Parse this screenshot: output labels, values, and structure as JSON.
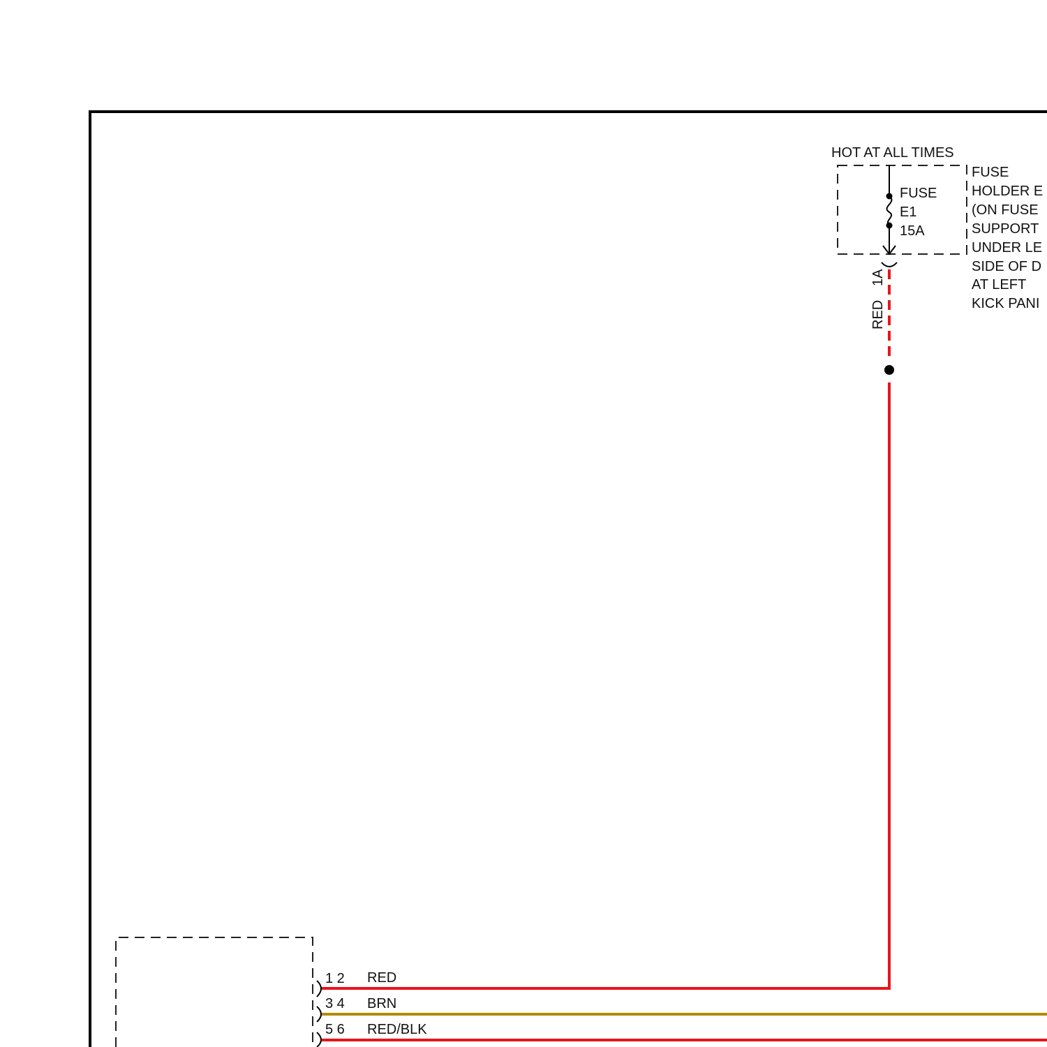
{
  "colors": {
    "frame": "#000000",
    "dashed_box": "#222222",
    "wire_red": "#e8141e",
    "wire_brown": "#b38a00",
    "wire_red_black": "#e8141e",
    "splice_dot": "#000000"
  },
  "power_note": "HOT AT ALL TIMES",
  "fuse": {
    "label_line1": "FUSE",
    "label_line2": "E1",
    "rating": "15A"
  },
  "fuse_holder_location": [
    "FUSE",
    "HOLDER E",
    "(ON FUSE",
    "SUPPORT",
    "UNDER LE",
    "SIDE OF D",
    "AT LEFT",
    "KICK PANI"
  ],
  "fuse_output": {
    "terminal": "1A",
    "wire_color": "RED"
  },
  "connector": {
    "pins": [
      {
        "numbers": "1 2",
        "wire": "RED",
        "color_key": "wire_red"
      },
      {
        "numbers": "3 4",
        "wire": "BRN",
        "color_key": "wire_brown"
      },
      {
        "numbers": "5 6",
        "wire": "RED/BLK",
        "color_key": "wire_red_black"
      }
    ]
  }
}
